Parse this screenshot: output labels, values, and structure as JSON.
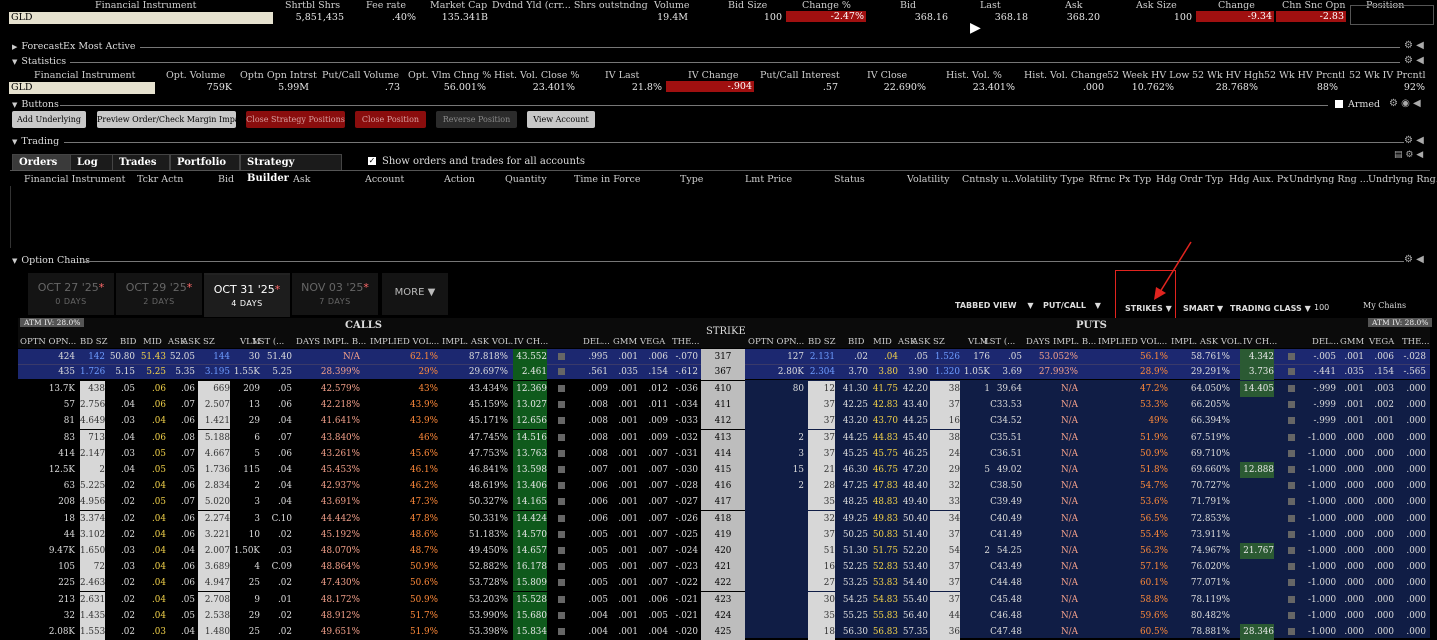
{
  "top_headers": [
    "Financial Instrument",
    "Shrtbl Shrs",
    "Fee rate",
    "Market Cap",
    "Dvdnd Yld (crr... Shrs outstndng",
    "Volume",
    "Bid Size",
    "Change %",
    "Bid",
    "Last",
    "Ask",
    "Ask Size",
    "Change",
    "Chn Snc Opn",
    "Position"
  ],
  "top_row": {
    "instrument": "GLD",
    "shrtbl": "5,851,435",
    "fee": ".40%",
    "mcap": "135.341B",
    "volume": "19.4M",
    "bid_size": "100",
    "change_pct": "-2.47%",
    "bid": "368.16",
    "last": "368.18",
    "ask": "368.20",
    "ask_size": "100",
    "change": "-9.34",
    "chn_snc": "-2.83"
  },
  "sections": {
    "forecastex": "ForecastEx Most Active",
    "statistics": "Statistics",
    "buttons": "Buttons",
    "trading": "Trading",
    "option_chains": "Option Chains"
  },
  "stats_headers": [
    "Financial Instrument",
    "Opt. Volume",
    "Optn Opn Intrst",
    "Put/Call Volume",
    "Opt. Vlm Chng %",
    "Hist. Vol. Close %",
    "IV Last",
    "IV Change",
    "Put/Call Interest",
    "IV Close",
    "Hist. Vol. %",
    "Hist. Vol. Change",
    "52 Week HV Low",
    "52 Wk HV Hgh",
    "52 Wk HV Prcntl",
    "52 Wk IV Prcntl"
  ],
  "stats_row": [
    "GLD",
    "759K",
    "5.99M",
    ".73",
    "56.001%",
    "23.401%",
    "21.8%",
    "-.904",
    ".57",
    "22.690%",
    "23.401%",
    ".000",
    "10.762%",
    "28.768%",
    "88%",
    "92%"
  ],
  "buttons": [
    "Add Underlying",
    "Preview Order/Check Margin Impact",
    "Close Strategy Positions",
    "Close Position",
    "Reverse Position",
    "View Account"
  ],
  "armed_label": "Armed",
  "tabs": [
    "Orders",
    "Log",
    "Trades",
    "Portfolio",
    "Strategy Builder"
  ],
  "show_all_label": "Show orders and trades for all accounts",
  "order_cols": [
    "Financial Instrument",
    "Tckr Actn",
    "Bid",
    "Ask",
    "Account",
    "Action",
    "Quantity",
    "Time in Force",
    "Type",
    "Lmt Price",
    "Status",
    "Volatility",
    "Cntnsly u...",
    "Volatility Type",
    "Rfrnc Px Typ",
    "Hdg Ordr Typ",
    "Hdg Aux. Px",
    "Undrlyng Rng ...",
    "Undrlyng Rng..."
  ],
  "expiries": [
    {
      "date": "OCT 27 '25",
      "days": "0 DAYS"
    },
    {
      "date": "OCT 29 '25",
      "days": "2 DAYS"
    },
    {
      "date": "OCT 31 '25",
      "days": "4 DAYS"
    },
    {
      "date": "NOV 03 '25",
      "days": "7 DAYS"
    }
  ],
  "more_label": "MORE",
  "controls": [
    "TABBED VIEW",
    "PUT/CALL",
    "STRIKES",
    "SMART",
    "TRADING CLASS",
    "100",
    "My Chains"
  ],
  "atm_iv": "ATM IV: 28.0%",
  "calls_label": "CALLS",
  "puts_label": "PUTS",
  "strike_label": "STRIKE",
  "call_headers": [
    "OPTN OPN...",
    "BD SZ",
    "BID",
    "MID",
    "ASK",
    "ASK SZ",
    "VLM",
    "LST (...",
    "DAYS",
    "IMPL. B...",
    "IMPLIED VOL...",
    "IMPL. ASK VOL.",
    "IV CH...",
    "DEL...",
    "GMM",
    "VEGA",
    "THE..."
  ],
  "put_headers": [
    "OPTN OPN...",
    "BD SZ",
    "BID",
    "MID",
    "ASK",
    "ASK SZ",
    "VLM",
    "LST (...",
    "DAYS",
    "IMPL. B...",
    "IMPLIED VOL...",
    "IMPL. ASK VOL.",
    "IV CH...",
    "DEL...",
    "GMM",
    "VEGA",
    "THE..."
  ],
  "combo_rows": [
    {
      "c": [
        "424",
        "142",
        "50.80",
        "51.43",
        "52.05",
        "144",
        "30",
        "51.40",
        "N/A",
        "62.1%",
        "87.818%",
        "43.552",
        ".995",
        ".001",
        ".006",
        "-.070"
      ],
      "strike": "317",
      "p": [
        "127",
        "2.131",
        ".02",
        ".04",
        ".05",
        "1.526",
        "176",
        ".05",
        "53.052%",
        "56.1%",
        "58.761%",
        "4.342",
        "-.005",
        ".001",
        ".006",
        "-.028"
      ]
    },
    {
      "c": [
        "435",
        "1.726",
        "5.15",
        "5.25",
        "5.35",
        "3.195",
        "1.55K",
        "5.25",
        "28.399%",
        "29%",
        "29.697%",
        "2.461",
        ".561",
        ".035",
        ".154",
        "-.612"
      ],
      "strike": "367",
      "p": [
        "2.80K",
        "2.304",
        "3.70",
        "3.80",
        "3.90",
        "1.320",
        "1.05K",
        "3.69",
        "27.993%",
        "28.9%",
        "29.291%",
        "3.736",
        "-.441",
        ".035",
        ".154",
        "-.565"
      ]
    }
  ],
  "rows": [
    {
      "c": [
        "13.7K",
        "438",
        ".05",
        ".06",
        ".06",
        "669",
        "209",
        ".05",
        "42.579%",
        "43%",
        "43.434%",
        "12.369",
        ".009",
        ".001",
        ".012",
        "-.036"
      ],
      "strike": "410",
      "p": [
        "80",
        "12",
        "41.30",
        "41.75",
        "42.20",
        "38",
        "1",
        "39.64",
        "N/A",
        "47.2%",
        "64.050%",
        "14.405",
        "-.999",
        ".001",
        ".003",
        ".000"
      ]
    },
    {
      "c": [
        "57",
        "2.756",
        ".04",
        ".06",
        ".07",
        "2.507",
        "13",
        ".06",
        "42.218%",
        "43.9%",
        "45.159%",
        "13.027",
        ".008",
        ".001",
        ".011",
        "-.034"
      ],
      "strike": "411",
      "p": [
        "",
        "37",
        "42.25",
        "42.83",
        "43.40",
        "37",
        "",
        "C33.53",
        "N/A",
        "53.3%",
        "66.205%",
        "",
        "-.999",
        ".001",
        ".002",
        ".000"
      ]
    },
    {
      "c": [
        "81",
        "4.649",
        ".03",
        ".04",
        ".06",
        "1.421",
        "29",
        ".04",
        "41.641%",
        "43.9%",
        "45.171%",
        "12.656",
        ".008",
        ".001",
        ".009",
        "-.033"
      ],
      "strike": "412",
      "p": [
        "",
        "37",
        "43.20",
        "43.70",
        "44.25",
        "16",
        "",
        "C34.52",
        "N/A",
        "49%",
        "66.394%",
        "",
        "-.999",
        ".001",
        ".001",
        ".000"
      ]
    },
    {
      "c": [
        "83",
        "713",
        ".04",
        ".06",
        ".08",
        "5.188",
        "6",
        ".07",
        "43.840%",
        "46%",
        "47.745%",
        "14.516",
        ".008",
        ".001",
        ".009",
        "-.032"
      ],
      "strike": "413",
      "p": [
        "2",
        "37",
        "44.25",
        "44.83",
        "45.40",
        "38",
        "",
        "C35.51",
        "N/A",
        "51.9%",
        "67.519%",
        "",
        "-1.000",
        ".000",
        ".000",
        ".000"
      ]
    },
    {
      "c": [
        "414",
        "2.147",
        ".03",
        ".05",
        ".07",
        "4.667",
        "5",
        ".06",
        "43.261%",
        "45.6%",
        "47.753%",
        "13.763",
        ".008",
        ".001",
        ".007",
        "-.031"
      ],
      "strike": "414",
      "p": [
        "3",
        "37",
        "45.25",
        "45.75",
        "46.25",
        "24",
        "",
        "C36.51",
        "N/A",
        "50.9%",
        "69.710%",
        "",
        "-1.000",
        ".000",
        ".000",
        ".000"
      ]
    },
    {
      "c": [
        "12.5K",
        "2",
        ".04",
        ".05",
        ".05",
        "1.736",
        "115",
        ".04",
        "45.453%",
        "46.1%",
        "46.841%",
        "13.598",
        ".007",
        ".001",
        ".007",
        "-.030"
      ],
      "strike": "415",
      "p": [
        "15",
        "21",
        "46.30",
        "46.75",
        "47.20",
        "29",
        "5",
        "49.02",
        "N/A",
        "51.8%",
        "69.660%",
        "12.888",
        "-1.000",
        ".000",
        ".000",
        ".000"
      ]
    },
    {
      "c": [
        "63",
        "5.225",
        ".02",
        ".04",
        ".06",
        "2.834",
        "2",
        ".04",
        "42.937%",
        "46.2%",
        "48.619%",
        "13.406",
        ".006",
        ".001",
        ".007",
        "-.028"
      ],
      "strike": "416",
      "p": [
        "2",
        "28",
        "47.25",
        "47.83",
        "48.40",
        "32",
        "",
        "C38.50",
        "N/A",
        "54.7%",
        "70.727%",
        "",
        "-1.000",
        ".000",
        ".000",
        ".000"
      ]
    },
    {
      "c": [
        "208",
        "4.956",
        ".02",
        ".05",
        ".07",
        "5.020",
        "3",
        ".04",
        "43.691%",
        "47.3%",
        "50.327%",
        "14.165",
        ".006",
        ".001",
        ".007",
        "-.027"
      ],
      "strike": "417",
      "p": [
        "",
        "35",
        "48.25",
        "48.83",
        "49.40",
        "33",
        "",
        "C39.49",
        "N/A",
        "53.6%",
        "71.791%",
        "",
        "-1.000",
        ".000",
        ".000",
        ".000"
      ]
    },
    {
      "c": [
        "18",
        "3.374",
        ".02",
        ".04",
        ".06",
        "2.274",
        "3",
        "C.10",
        "44.442%",
        "47.8%",
        "50.331%",
        "14.424",
        ".006",
        ".001",
        ".007",
        "-.026"
      ],
      "strike": "418",
      "p": [
        "",
        "32",
        "49.25",
        "49.83",
        "50.40",
        "34",
        "",
        "C40.49",
        "N/A",
        "56.5%",
        "72.853%",
        "",
        "-1.000",
        ".000",
        ".000",
        ".000"
      ]
    },
    {
      "c": [
        "44",
        "3.102",
        ".02",
        ".04",
        ".06",
        "3.221",
        "10",
        ".02",
        "45.192%",
        "48.6%",
        "51.183%",
        "14.570",
        ".005",
        ".001",
        ".007",
        "-.025"
      ],
      "strike": "419",
      "p": [
        "",
        "37",
        "50.25",
        "50.83",
        "51.40",
        "37",
        "",
        "C41.49",
        "N/A",
        "55.4%",
        "73.911%",
        "",
        "-1.000",
        ".000",
        ".000",
        ".000"
      ]
    },
    {
      "c": [
        "9.47K",
        "1.650",
        ".03",
        ".04",
        ".04",
        "2.007",
        "1.50K",
        ".03",
        "48.070%",
        "48.7%",
        "49.450%",
        "14.657",
        ".005",
        ".001",
        ".007",
        "-.024"
      ],
      "strike": "420",
      "p": [
        "",
        "51",
        "51.30",
        "51.75",
        "52.20",
        "54",
        "2",
        "54.25",
        "N/A",
        "56.3%",
        "74.967%",
        "21.767",
        "-1.000",
        ".000",
        ".000",
        ".000"
      ]
    },
    {
      "c": [
        "105",
        "72",
        ".03",
        ".04",
        ".06",
        "3.689",
        "4",
        "C.09",
        "48.864%",
        "50.9%",
        "52.882%",
        "16.178",
        ".005",
        ".001",
        ".007",
        "-.023"
      ],
      "strike": "421",
      "p": [
        "",
        "16",
        "52.25",
        "52.83",
        "53.40",
        "37",
        "",
        "C43.49",
        "N/A",
        "57.1%",
        "76.020%",
        "",
        "-1.000",
        ".000",
        ".000",
        ".000"
      ]
    },
    {
      "c": [
        "225",
        "2.463",
        ".02",
        ".04",
        ".06",
        "4.947",
        "25",
        ".02",
        "47.430%",
        "50.6%",
        "53.728%",
        "15.809",
        ".005",
        ".001",
        ".007",
        "-.022"
      ],
      "strike": "422",
      "p": [
        "",
        "27",
        "53.25",
        "53.83",
        "54.40",
        "37",
        "",
        "C44.48",
        "N/A",
        "60.1%",
        "77.071%",
        "",
        "-1.000",
        ".000",
        ".000",
        ".000"
      ]
    },
    {
      "c": [
        "213",
        "2.631",
        ".02",
        ".04",
        ".05",
        "2.708",
        "9",
        ".01",
        "48.172%",
        "50.9%",
        "53.203%",
        "15.528",
        ".005",
        ".001",
        ".006",
        "-.021"
      ],
      "strike": "423",
      "p": [
        "",
        "30",
        "54.25",
        "54.83",
        "55.40",
        "37",
        "",
        "C45.48",
        "N/A",
        "58.8%",
        "78.119%",
        "",
        "-1.000",
        ".000",
        ".000",
        ".000"
      ]
    },
    {
      "c": [
        "32",
        "1.435",
        ".02",
        ".04",
        ".05",
        "2.538",
        "29",
        ".02",
        "48.912%",
        "51.7%",
        "53.990%",
        "15.680",
        ".004",
        ".001",
        ".005",
        "-.021"
      ],
      "strike": "424",
      "p": [
        "",
        "35",
        "55.25",
        "55.83",
        "56.40",
        "44",
        "",
        "C46.48",
        "N/A",
        "59.6%",
        "80.482%",
        "",
        "-1.000",
        ".000",
        ".000",
        ".000"
      ]
    },
    {
      "c": [
        "2.08K",
        "1.553",
        ".02",
        ".03",
        ".04",
        "1.480",
        "25",
        ".02",
        "49.651%",
        "51.9%",
        "53.398%",
        "15.834",
        ".004",
        ".001",
        ".004",
        "-.020"
      ],
      "strike": "425",
      "p": [
        "",
        "18",
        "56.30",
        "56.83",
        "57.35",
        "36",
        "",
        "C47.48",
        "N/A",
        "60.5%",
        "78.881%",
        "28.346",
        "-1.000",
        ".000",
        ".000",
        ".000"
      ]
    }
  ]
}
